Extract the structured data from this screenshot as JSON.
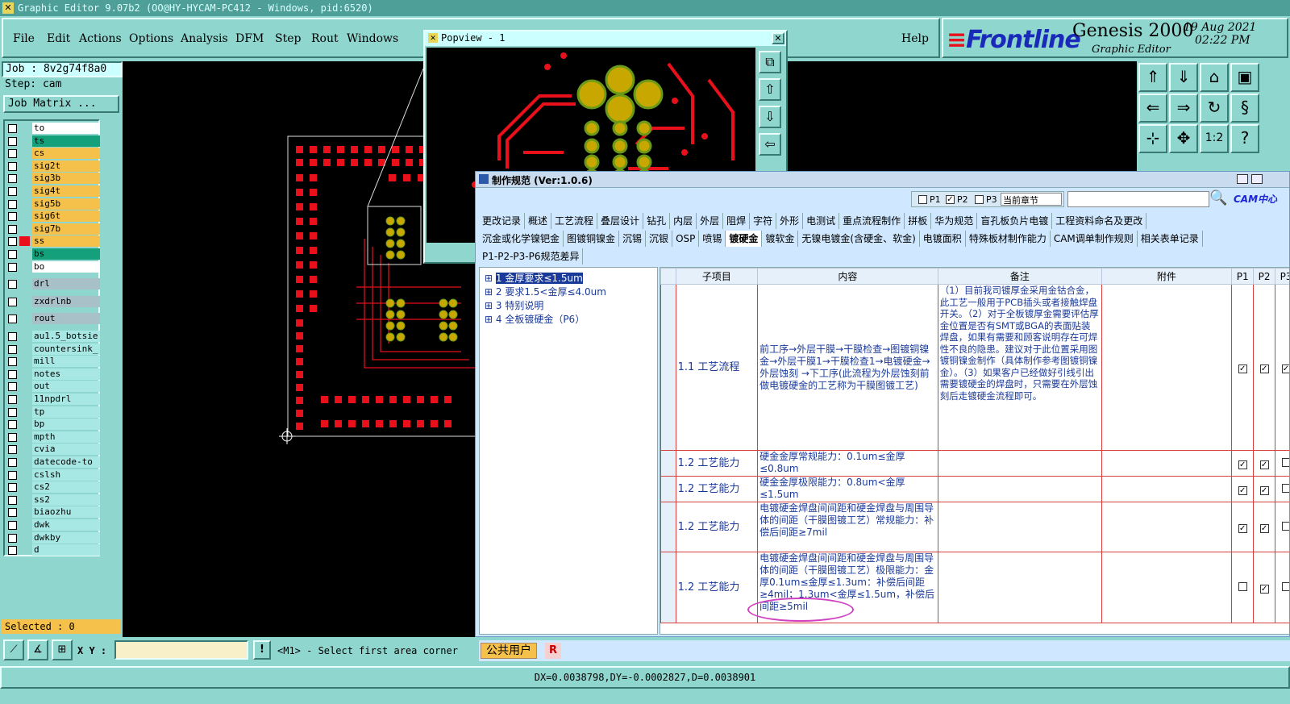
{
  "window": {
    "title": "Graphic Editor 9.07b2 (OO@HY-HYCAM-PC412 - Windows, pid:6520)"
  },
  "menu": {
    "items": [
      "File",
      "Edit",
      "Actions",
      "Options",
      "Analysis",
      "DFM",
      "Step",
      "Rout",
      "Windows"
    ],
    "help": "Help"
  },
  "brand": {
    "logo": "Frontline",
    "product": "Genesis 2000",
    "subtitle": "Graphic Editor",
    "date": "19 Aug 2021",
    "time": "02:22 PM"
  },
  "job": {
    "job": "Job : 8v2g74f8a0",
    "step": "Step: cam",
    "matrix_button": "Job Matrix ..."
  },
  "layers": [
    {
      "name": "to",
      "color": "#ffffff"
    },
    {
      "name": "ts",
      "color": "#14a07a"
    },
    {
      "name": "cs",
      "color": "#f5c14a"
    },
    {
      "name": "sig2t",
      "color": "#f5c14a"
    },
    {
      "name": "sig3b",
      "color": "#f5c14a"
    },
    {
      "name": "sig4t",
      "color": "#f5c14a"
    },
    {
      "name": "sig5b",
      "color": "#f5c14a"
    },
    {
      "name": "sig6t",
      "color": "#f5c14a"
    },
    {
      "name": "sig7b",
      "color": "#f5c14a"
    },
    {
      "name": "ss",
      "color": "#f5c14a"
    },
    {
      "name": "bs",
      "color": "#14a07a"
    },
    {
      "name": "bo",
      "color": "#ffffff"
    },
    {
      "name": "drl",
      "color": "#a8c0c8"
    },
    {
      "name": "zxdrlnb",
      "color": "#a8c0c8"
    },
    {
      "name": "rout",
      "color": "#a8c0c8"
    },
    {
      "name": "au1.5_botsie",
      "color": "#a8e8e4"
    },
    {
      "name": "countersink_",
      "color": "#a8e8e4"
    },
    {
      "name": "mill",
      "color": "#a8e8e4"
    },
    {
      "name": "notes",
      "color": "#a8e8e4"
    },
    {
      "name": "out",
      "color": "#a8e8e4"
    },
    {
      "name": "11npdrl",
      "color": "#a8e8e4"
    },
    {
      "name": "tp",
      "color": "#a8e8e4"
    },
    {
      "name": "bp",
      "color": "#a8e8e4"
    },
    {
      "name": "mpth",
      "color": "#a8e8e4"
    },
    {
      "name": "cvia",
      "color": "#a8e8e4"
    },
    {
      "name": "datecode-to",
      "color": "#a8e8e4"
    },
    {
      "name": "cslsh",
      "color": "#a8e8e4"
    },
    {
      "name": "cs2",
      "color": "#a8e8e4"
    },
    {
      "name": "ss2",
      "color": "#a8e8e4"
    },
    {
      "name": "biaozhu",
      "color": "#a8e8e4"
    },
    {
      "name": "dwk",
      "color": "#a8e8e4"
    },
    {
      "name": "dwkby",
      "color": "#a8e8e4"
    },
    {
      "name": "d",
      "color": "#a8e8e4"
    }
  ],
  "selected": "Selected : 0",
  "popview": {
    "title": "Popview - 1"
  },
  "spec": {
    "title": "制作规范 (Ver:1.0.6)",
    "filters": {
      "p1": "P1",
      "p2": "P2",
      "p3": "P3",
      "scope": "当前章节",
      "user": "CAM中心"
    },
    "tabs_row1": [
      "更改记录",
      "概述",
      "工艺流程",
      "叠层设计",
      "钻孔",
      "内层",
      "外层",
      "阻焊",
      "字符",
      "外形",
      "电测试",
      "重点流程制作",
      "拼板",
      "华为规范",
      "盲孔板负片电镀",
      "工程资料命名及更改"
    ],
    "tabs_row2": [
      "沉金或化学镍钯金",
      "图镀铜镍金",
      "沉锡",
      "沉银",
      "OSP",
      "喷锡",
      "镀硬金",
      "镀软金",
      "无镍电镀金(含硬金、软金)",
      "电镀面积",
      "特殊板材制作能力",
      "CAM调单制作规则",
      "相关表单记录"
    ],
    "tabs_row3": [
      "P1-P2-P3-P6规范差异"
    ],
    "active_tab": "镀硬金",
    "tree": [
      "1 金厚要求≤1.5um",
      "2 要求1.5<金厚≤4.0um",
      "3 特别说明",
      "4 全板镀硬金（P6）"
    ],
    "columns": [
      "子项目",
      "内容",
      "备注",
      "附件",
      "P1",
      "P2",
      "P3"
    ],
    "rows": [
      {
        "sub": "1.1 工艺流程",
        "content": "前工序→外层干膜→干膜检查→图镀铜镍金→外层干膜1→干膜检查1→电镀硬金→外层蚀刻 →下工序(此流程为外层蚀刻前做电镀硬金的工艺称为干膜图镀工艺)",
        "note": "（1）目前我司镀厚金采用金钴合金，此工艺一般用于PCB插头或者接触焊盘开关。（2）对于全板镀厚金需要评估厚金位置是否有SMT或BGA的表面贴装焊盘，如果有需要和顾客说明存在可焊性不良的隐患。建议对于此位置采用图镀铜镍金制作（具体制作参考图镀铜镍金）。（3）如果客户已经做好引线引出需要镀硬金的焊盘时，只需要在外层蚀刻后走镀硬金流程即可。",
        "p": [
          true,
          true,
          true
        ]
      },
      {
        "sub": "1.2 工艺能力",
        "content": "硬金金厚常规能力：0.1um≤金厚≤0.8um",
        "note": "",
        "p": [
          true,
          true,
          false
        ]
      },
      {
        "sub": "1.2 工艺能力",
        "content": "硬金金厚极限能力：0.8um<金厚≤1.5um",
        "note": "",
        "p": [
          true,
          true,
          false
        ]
      },
      {
        "sub": "1.2 工艺能力",
        "content": "电镀硬金焊盘间间距和硬金焊盘与周围导体的间距（干膜图镀工艺）常规能力：补偿后间距≥7mil",
        "note": "",
        "p": [
          true,
          true,
          false
        ]
      },
      {
        "sub": "1.2 工艺能力",
        "content": "电镀硬金焊盘间间距和硬金焊盘与周围导体的间距（干膜图镀工艺）极限能力：金厚0.1um≤金厚≤1.3um：补偿后间距≥4mil；1.3um<金厚≤1.5um，补偿后间距≥5mil",
        "note": "",
        "p": [
          false,
          true,
          false
        ]
      }
    ],
    "footer_user": "公共用户",
    "footer_r": "R"
  },
  "command": {
    "xy_label": "X Y :",
    "xy_value": "",
    "prompt": "<M1> - Select first area corner"
  },
  "status": {
    "text": "DX=0.0038798,DY=-0.0002827,D=0.0038901"
  },
  "colors": {
    "panel": "#8fd6cf",
    "pcb_red": "#e8101a",
    "pcb_pad": "#c8a800",
    "arrow": "#1d24d8",
    "highlight": "#d040c0"
  }
}
